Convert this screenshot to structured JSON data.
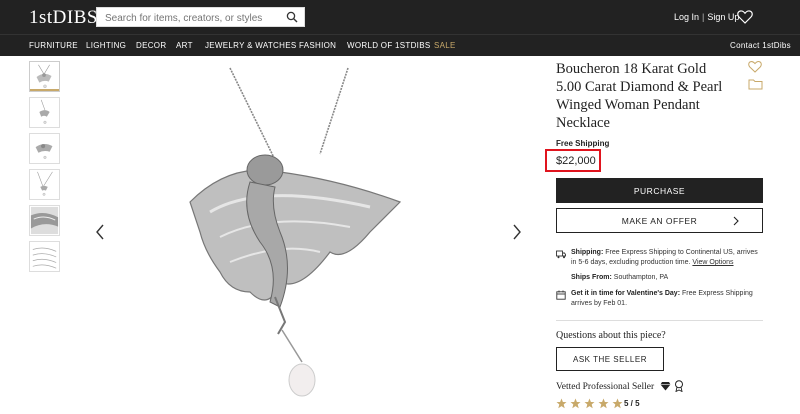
{
  "header": {
    "logo": "1stDIBS",
    "search_placeholder": "Search for items, creators, or styles",
    "login": "Log In",
    "separator": "|",
    "signup": "Sign Up"
  },
  "nav": {
    "items": [
      "FURNITURE",
      "LIGHTING",
      "DECOR",
      "ART",
      "JEWELRY & WATCHES",
      "FASHION",
      "WORLD OF 1STDIBS",
      "SALE"
    ],
    "contact": "Contact 1stDibs"
  },
  "product": {
    "title": "Boucheron 18 Karat Gold 5.00 Carat Diamond & Pearl Winged Woman Pendant Necklace",
    "free_shipping": "Free Shipping",
    "price": "$22,000",
    "purchase_label": "PURCHASE",
    "offer_label": "MAKE AN OFFER"
  },
  "shipping": {
    "label": "Shipping:",
    "text": " Free Express Shipping to Continental US, arrives in 5-6 days, excluding production time. ",
    "link": "View Options",
    "ships_from_label": "Ships From:",
    "ships_from": " Southampton, PA",
    "valentine_label": "Get it in time for Valentine's Day:",
    "valentine_text": " Free Express Shipping arrives by Feb 01."
  },
  "seller": {
    "questions": "Questions about this piece?",
    "ask_label": "ASK THE SELLER",
    "vetted": "Vetted Professional Seller",
    "rating": "5 / 5",
    "stars": 5
  },
  "colors": {
    "header_bg": "#222222",
    "sale": "#c8a96a",
    "highlight_box": "#e0141e",
    "star": "#c8a96a"
  }
}
